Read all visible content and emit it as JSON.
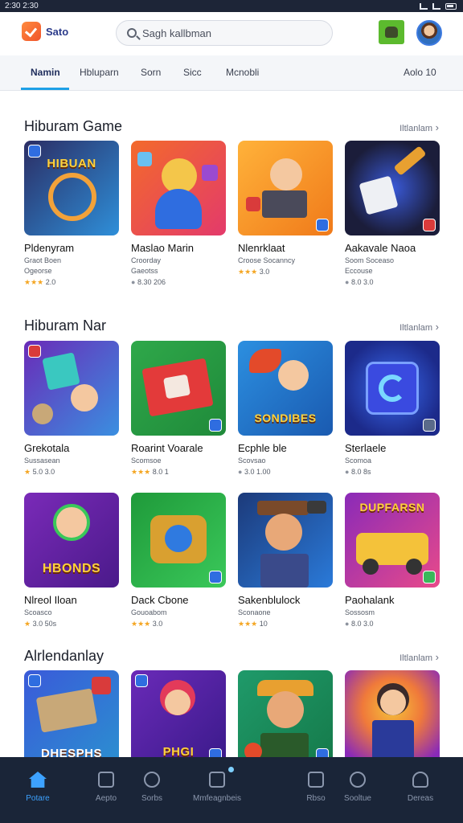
{
  "status_bar": {
    "time": "2:30 2:30"
  },
  "header": {
    "logo_text": "Sato",
    "search_placeholder": "Sagh kallbman"
  },
  "tabs": [
    {
      "label": "Namin",
      "active": true
    },
    {
      "label": "Hbluparn"
    },
    {
      "label": "Sorn"
    },
    {
      "label": "Sicc"
    },
    {
      "label": "Mcnobli"
    },
    {
      "label": "Aolo 10"
    }
  ],
  "sections": [
    {
      "title": "Hiburam Game",
      "more": "Iltlanlam",
      "cards": [
        {
          "name": "Pldenyram",
          "sub": "Graot Boen",
          "sub2": "Ogeorse",
          "rating": "2.0",
          "stars": 3,
          "art": "HIBUAN",
          "colors": [
            "#2b2d64",
            "#2e8fd9",
            "#f2a23a"
          ]
        },
        {
          "name": "Maslao Marin",
          "sub": "Croorday",
          "sub2": "Gaeotss",
          "rating": "8.30 206",
          "stars": 0,
          "art": "",
          "colors": [
            "#f36a2b",
            "#f4c64a",
            "#e33a6b"
          ]
        },
        {
          "name": "Nlenrklaat",
          "sub": "Croose Socanncy",
          "sub2": "",
          "rating": "3.0",
          "stars": 3,
          "art": "",
          "colors": [
            "#ffb23a",
            "#f07a1a",
            "#7a3ab8"
          ]
        },
        {
          "name": "Aakavale Naoa",
          "sub": "Soom Soceaso",
          "sub2": "Eccouse",
          "rating": "8.0 3.0",
          "stars": 0,
          "art": "",
          "colors": [
            "#1b1d3a",
            "#3a5ad9",
            "#e8a030"
          ]
        }
      ]
    },
    {
      "title": "Hiburam Nar",
      "more": "Iltlanlam",
      "cards": [
        {
          "name": "Grekotala",
          "sub": "Sussasean",
          "sub2": "",
          "rating": "5.0 3.0",
          "stars": 1,
          "art": "",
          "colors": [
            "#6a2bb8",
            "#3a8fe0",
            "#f4a23a"
          ]
        },
        {
          "name": "Roarint Voarale",
          "sub": "Scomsoe",
          "sub2": "",
          "rating": "8.0 1",
          "stars": 3,
          "art": "",
          "colors": [
            "#2fa84a",
            "#e33a3a",
            "#f4d24a"
          ]
        },
        {
          "name": "Ecphle ble",
          "sub": "Scovsao",
          "sub2": "",
          "rating": "3.0 1.00",
          "stars": 0,
          "art": "SONDIBES",
          "colors": [
            "#2c8fe0",
            "#f4c23a",
            "#e34a2a"
          ]
        },
        {
          "name": "Sterlaele",
          "sub": "Scomoa",
          "sub2": "",
          "rating": "8.0 8s",
          "stars": 0,
          "art": "",
          "colors": [
            "#1c2a8a",
            "#3a6af0",
            "#7a4ae0"
          ]
        }
      ]
    },
    {
      "title": "",
      "more": "",
      "cards": [
        {
          "name": "Nlreol Iloan",
          "sub": "Scoasco",
          "sub2": "",
          "rating": "3.0 50s",
          "stars": 1,
          "art": "HBONDS",
          "colors": [
            "#7a2ab8",
            "#f4b23a",
            "#e85a2a"
          ]
        },
        {
          "name": "Dack Cbone",
          "sub": "Gouoabom",
          "sub2": "",
          "rating": "3.0",
          "stars": 3,
          "art": "",
          "colors": [
            "#1f9a3a",
            "#3ac85a",
            "#f4c23a"
          ]
        },
        {
          "name": "Sakenblulock",
          "sub": "Sconaone",
          "sub2": "",
          "rating": "10",
          "stars": 3,
          "art": "",
          "colors": [
            "#1c3a7a",
            "#2a7ad9",
            "#d98a3a"
          ]
        },
        {
          "name": "Paohalank",
          "sub": "Sossosm",
          "sub2": "",
          "rating": "8.0 3.0",
          "stars": 0,
          "art": "DUPFARSN",
          "colors": [
            "#8a2ab8",
            "#e84a8a",
            "#f4c23a"
          ]
        }
      ]
    },
    {
      "title": "Alrlendanlay",
      "more": "Iltlanlam",
      "cards": [
        {
          "name": "",
          "sub": "",
          "sub2": "",
          "rating": "",
          "stars": 0,
          "art": "DHESPHS",
          "colors": [
            "#3a5ad9",
            "#f4a23a",
            "#2b8fd0"
          ]
        },
        {
          "name": "",
          "sub": "",
          "sub2": "",
          "rating": "",
          "stars": 0,
          "art": "PHGI",
          "colors": [
            "#6a2ab8",
            "#e33a5a",
            "#f4c23a"
          ]
        },
        {
          "name": "",
          "sub": "",
          "sub2": "",
          "rating": "",
          "stars": 0,
          "art": "",
          "colors": [
            "#1f9a6a",
            "#f4b23a",
            "#e34a2a"
          ]
        },
        {
          "name": "",
          "sub": "",
          "sub2": "",
          "rating": "",
          "stars": 0,
          "art": "",
          "colors": [
            "#8a2ab8",
            "#f07a3a",
            "#f4c23a"
          ]
        }
      ]
    }
  ],
  "bottom_nav": [
    {
      "label": "Potare",
      "icon": "home-icon",
      "active": true
    },
    {
      "label": "Aepto",
      "icon": "screen-icon"
    },
    {
      "label": "Sorbs",
      "icon": "gamepad-icon"
    },
    {
      "label": "Mmfeagnbeis",
      "icon": "document-icon"
    },
    {
      "label": "Rbso",
      "icon": "checklist-icon"
    },
    {
      "label": "Sooltue",
      "icon": "search-icon"
    },
    {
      "label": "Dereas",
      "icon": "person-icon"
    }
  ]
}
